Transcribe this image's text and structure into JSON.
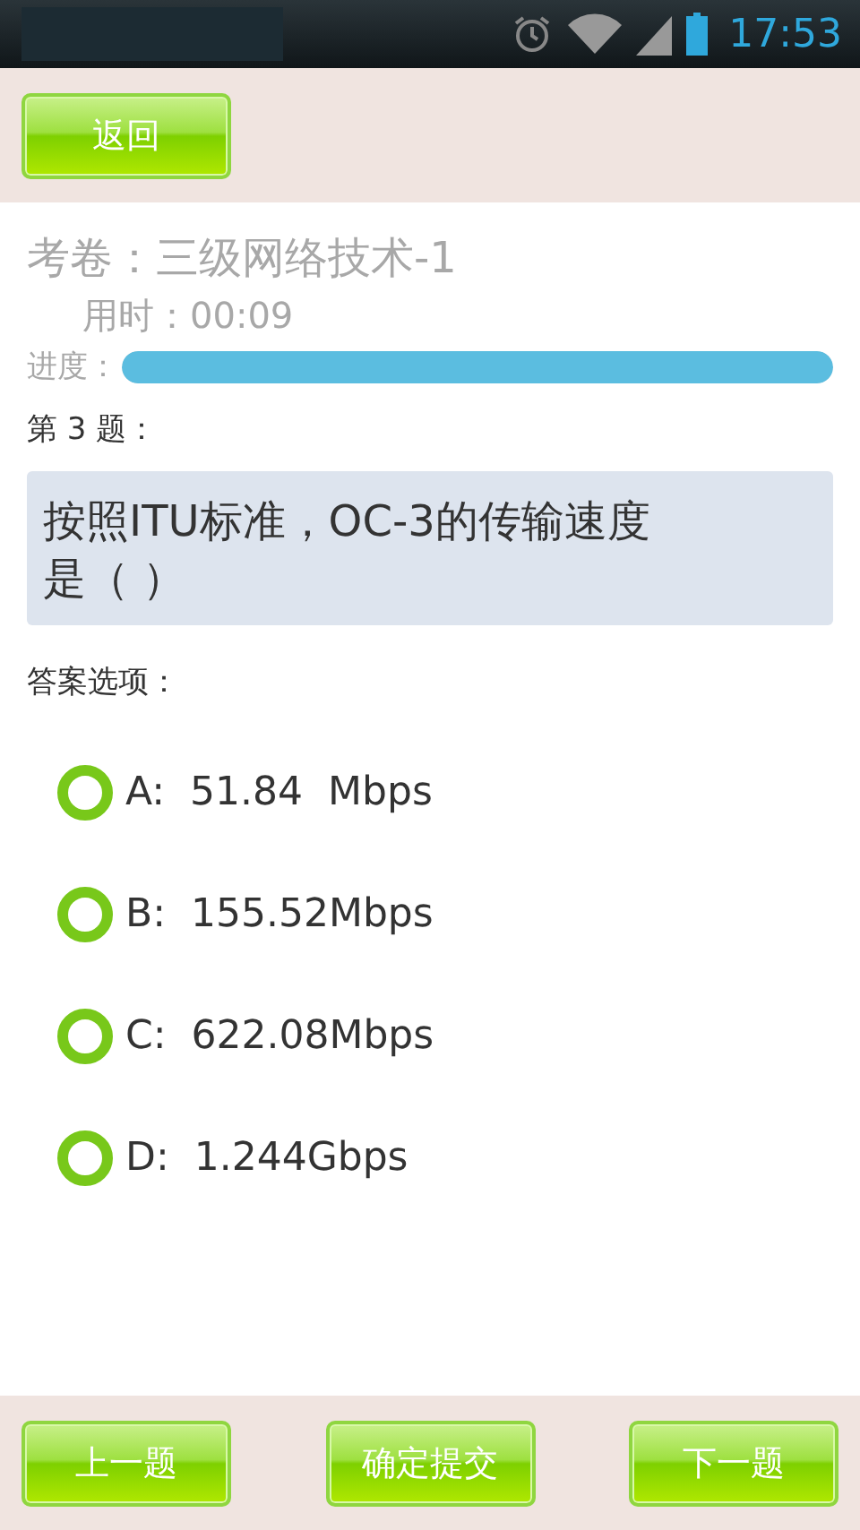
{
  "status_bar": {
    "time": "17:53"
  },
  "back_button": "返回",
  "exam": {
    "title": "考卷：三级网络技术-1",
    "elapsed": "用时：00:09",
    "progress_label": "进度：",
    "progress": {
      "level": 1
    }
  },
  "question": {
    "number": "第 3 题：",
    "text": "按照ITU标准，OC-3的传输速度是（ ）"
  },
  "options_label": "答案选项：",
  "options": [
    {
      "label": "A:  51.84  Mbps",
      "selected": false
    },
    {
      "label": "B:  155.52Mbps",
      "selected": false
    },
    {
      "label": "C:  622.08Mbps",
      "selected": false
    },
    {
      "label": "D:  1.244Gbps",
      "selected": false
    }
  ],
  "footer_buttons": [
    "上一题",
    "确定提交",
    "下一题"
  ]
}
